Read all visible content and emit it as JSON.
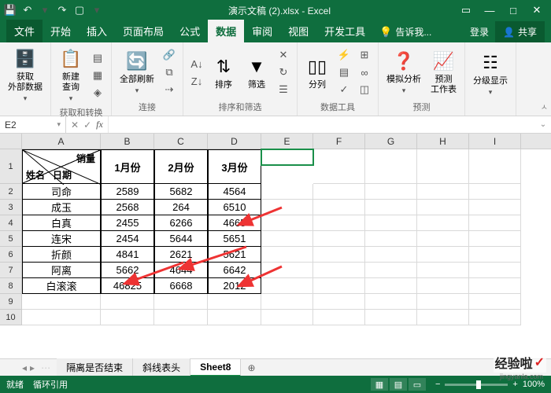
{
  "title": "演示文稿 (2).xlsx - Excel",
  "tabs": {
    "file": "文件",
    "home": "开始",
    "insert": "插入",
    "layout": "页面布局",
    "formulas": "公式",
    "data": "数据",
    "review": "审阅",
    "view": "视图",
    "dev": "开发工具",
    "tell": "告诉我...",
    "login": "登录",
    "share": "共享"
  },
  "ribbon": {
    "get_data": "获取\n外部数据",
    "new_query": "新建\n查询",
    "group1": "获取和转换",
    "refresh": "全部刷新",
    "group2": "连接",
    "sort": "排序",
    "filter": "筛选",
    "group3": "排序和筛选",
    "split": "分列",
    "group4": "数据工具",
    "whatif": "模拟分析",
    "forecast": "预测\n工作表",
    "group5": "预测",
    "outline": "分级显示"
  },
  "namebox": "E2",
  "col_headers": [
    "A",
    "B",
    "C",
    "D",
    "E",
    "F",
    "G",
    "H",
    "I"
  ],
  "header": {
    "sales": "销量",
    "date": "日期",
    "name": "姓名",
    "m1": "1月份",
    "m2": "2月份",
    "m3": "3月份"
  },
  "rows": [
    {
      "n": "2",
      "name": "司命",
      "v": [
        "2589",
        "5682",
        "4564"
      ]
    },
    {
      "n": "3",
      "name": "成玉",
      "v": [
        "2568",
        "264",
        "6510"
      ]
    },
    {
      "n": "4",
      "name": "白真",
      "v": [
        "2455",
        "6266",
        "4665"
      ]
    },
    {
      "n": "5",
      "name": "连宋",
      "v": [
        "2454",
        "5644",
        "5651"
      ]
    },
    {
      "n": "6",
      "name": "折颜",
      "v": [
        "4841",
        "2621",
        "5621"
      ]
    },
    {
      "n": "7",
      "name": "阿离",
      "v": [
        "5662",
        "4644",
        "6642"
      ]
    },
    {
      "n": "8",
      "name": "白滚滚",
      "v": [
        "46825",
        "6668",
        "2012"
      ]
    }
  ],
  "empty_rows": [
    "9",
    "10"
  ],
  "sheets": {
    "s1": "隔离是否结束",
    "s2": "斜线表头",
    "s3": "Sheet8"
  },
  "status": {
    "ready": "就绪",
    "circ": "循环引用",
    "zoom": "100%"
  },
  "watermark": "经验啦",
  "watermark_sub": "jingyanla.com"
}
